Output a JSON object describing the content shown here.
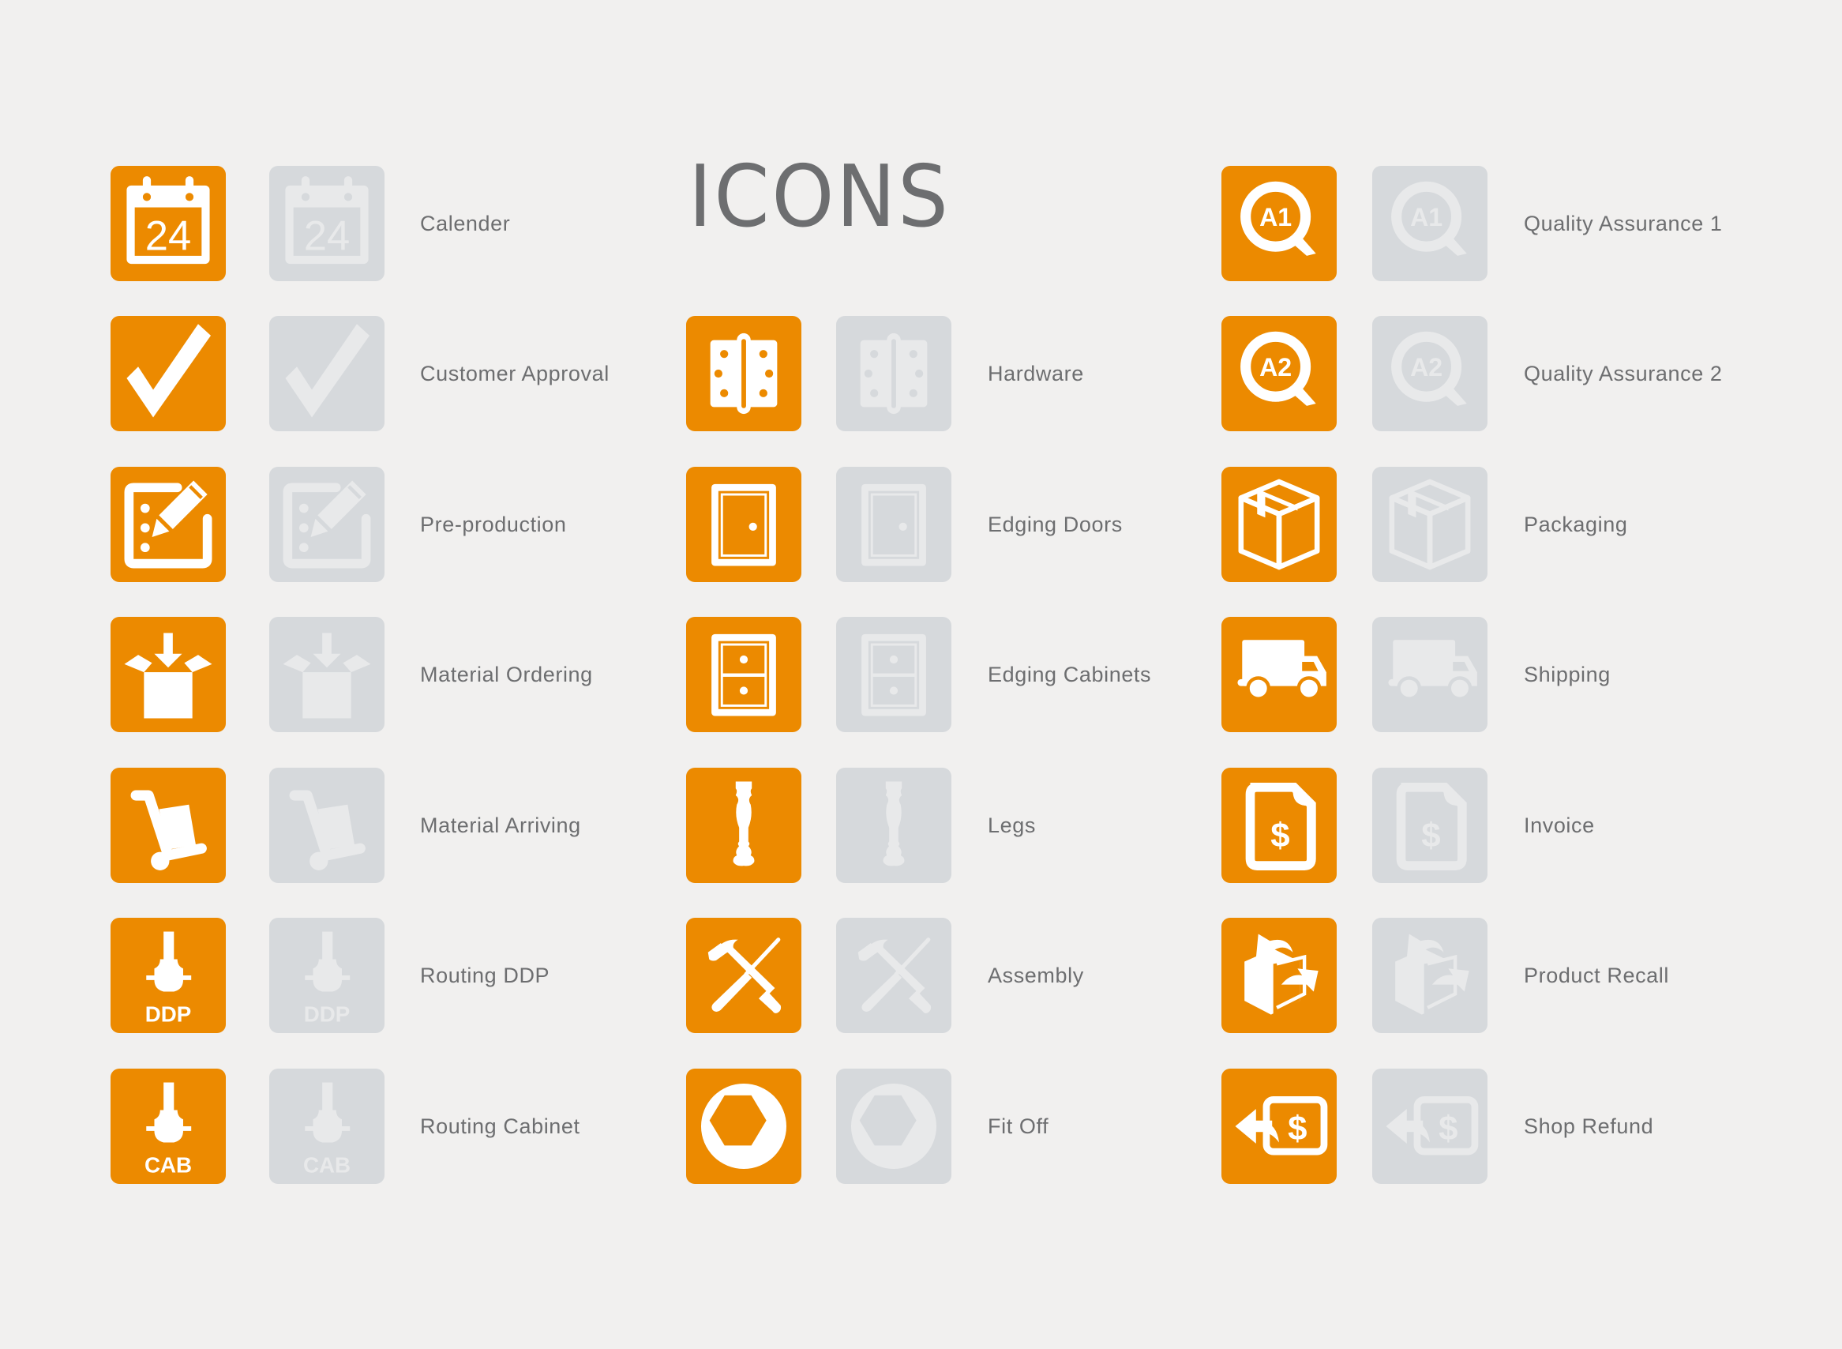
{
  "title": "ICONS",
  "colors": {
    "active_bg": "#ec8a00",
    "active_fg": "#ffffff",
    "inactive_bg": "#d6d9dc",
    "inactive_fg": "#e8e9ea",
    "label": "#6d6e70",
    "page_bg": "#f1f0ef"
  },
  "columns": [
    {
      "items": [
        {
          "label": "Calender",
          "icon": "calendar-icon",
          "icon_text": "24"
        },
        {
          "label": "Customer Approval",
          "icon": "checkmark-icon"
        },
        {
          "label": "Pre-production",
          "icon": "edit-checklist-icon"
        },
        {
          "label": "Material Ordering",
          "icon": "box-in-icon"
        },
        {
          "label": "Material Arriving",
          "icon": "hand-truck-icon"
        },
        {
          "label": "Routing DDP",
          "icon": "router-bit-icon",
          "icon_text": "DDP"
        },
        {
          "label": "Routing Cabinet",
          "icon": "router-bit-icon",
          "icon_text": "CAB"
        }
      ]
    },
    {
      "items": [
        {
          "label": "Hardware",
          "icon": "hinge-icon"
        },
        {
          "label": "Edging Doors",
          "icon": "door-icon"
        },
        {
          "label": "Edging Cabinets",
          "icon": "cabinet-icon"
        },
        {
          "label": "Legs",
          "icon": "table-leg-icon"
        },
        {
          "label": "Assembly",
          "icon": "hammer-screwdriver-icon"
        },
        {
          "label": "Fit Off",
          "icon": "hex-nut-icon"
        }
      ]
    },
    {
      "items": [
        {
          "label": "Quality Assurance 1",
          "icon": "magnifier-icon",
          "icon_text": "A1"
        },
        {
          "label": "Quality Assurance 2",
          "icon": "magnifier-icon",
          "icon_text": "A2"
        },
        {
          "label": "Packaging",
          "icon": "package-icon"
        },
        {
          "label": "Shipping",
          "icon": "truck-icon"
        },
        {
          "label": "Invoice",
          "icon": "invoice-icon",
          "icon_text": "$"
        },
        {
          "label": "Product Recall",
          "icon": "product-recall-icon"
        },
        {
          "label": "Shop Refund",
          "icon": "refund-icon",
          "icon_text": "$"
        }
      ]
    }
  ]
}
